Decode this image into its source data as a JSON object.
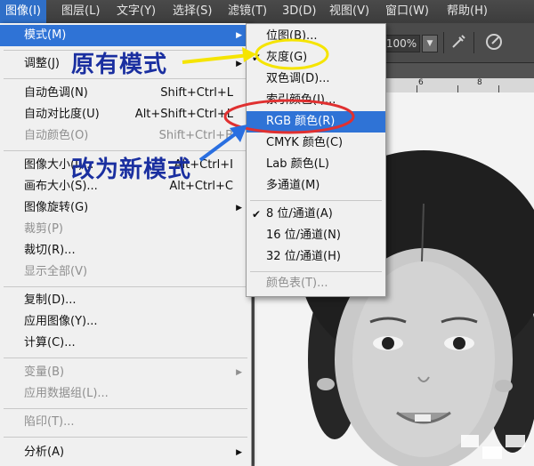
{
  "menubar": {
    "items": [
      "图像(I)",
      "图层(L)",
      "文字(Y)",
      "选择(S)",
      "滤镜(T)",
      "3D(D)",
      "视图(V)",
      "窗口(W)",
      "帮助(H)"
    ]
  },
  "options_bar": {
    "zoom": "100%"
  },
  "ruler": {
    "labels": [
      "6",
      "8"
    ]
  },
  "image_menu": {
    "items": [
      {
        "label": "模式(M)",
        "shortcut": "",
        "submenu": true
      },
      {
        "label": "调整(J)",
        "shortcut": "",
        "submenu": true
      },
      {
        "label": "自动色调(N)",
        "shortcut": "Shift+Ctrl+L"
      },
      {
        "label": "自动对比度(U)",
        "shortcut": "Alt+Shift+Ctrl+L"
      },
      {
        "label": "自动颜色(O)",
        "shortcut": "Shift+Ctrl+B",
        "disabled": true
      },
      {
        "label": "图像大小(I)...",
        "shortcut": "Alt+Ctrl+I"
      },
      {
        "label": "画布大小(S)...",
        "shortcut": "Alt+Ctrl+C"
      },
      {
        "label": "图像旋转(G)",
        "shortcut": "",
        "submenu": true
      },
      {
        "label": "裁剪(P)",
        "shortcut": "",
        "disabled": true
      },
      {
        "label": "裁切(R)...",
        "shortcut": ""
      },
      {
        "label": "显示全部(V)",
        "shortcut": "",
        "disabled": true
      },
      {
        "label": "复制(D)...",
        "shortcut": ""
      },
      {
        "label": "应用图像(Y)...",
        "shortcut": ""
      },
      {
        "label": "计算(C)...",
        "shortcut": ""
      },
      {
        "label": "变量(B)",
        "shortcut": "",
        "submenu": true,
        "disabled": true
      },
      {
        "label": "应用数据组(L)...",
        "shortcut": "",
        "disabled": true
      },
      {
        "label": "陷印(T)...",
        "shortcut": "",
        "disabled": true
      },
      {
        "label": "分析(A)",
        "shortcut": "",
        "submenu": true
      }
    ]
  },
  "mode_submenu": {
    "items": [
      {
        "label": "位图(B)...",
        "checked": false
      },
      {
        "label": "灰度(G)",
        "checked": true
      },
      {
        "label": "双色调(D)...",
        "checked": false
      },
      {
        "label": "索引颜色(I)...",
        "checked": false
      },
      {
        "label": "RGB 颜色(R)",
        "checked": false,
        "highlighted": true
      },
      {
        "label": "CMYK 颜色(C)",
        "checked": false
      },
      {
        "label": "Lab 颜色(L)",
        "checked": false
      },
      {
        "label": "多通道(M)",
        "checked": false
      },
      {
        "label": "8 位/通道(A)",
        "checked": true
      },
      {
        "label": "16 位/通道(N)",
        "checked": false
      },
      {
        "label": "32 位/通道(H)",
        "checked": false
      },
      {
        "label": "颜色表(T)...",
        "checked": false,
        "disabled": true
      }
    ]
  },
  "annotations": {
    "original_mode": "原有模式",
    "change_mode": "改为新模式"
  },
  "colors": {
    "menu_highlight": "#2f73d6",
    "annotation_text": "#1a2fa0",
    "annotation_yellow": "#f5e400",
    "annotation_red": "#e03030",
    "annotation_blue_arrow": "#2a6fe0"
  }
}
